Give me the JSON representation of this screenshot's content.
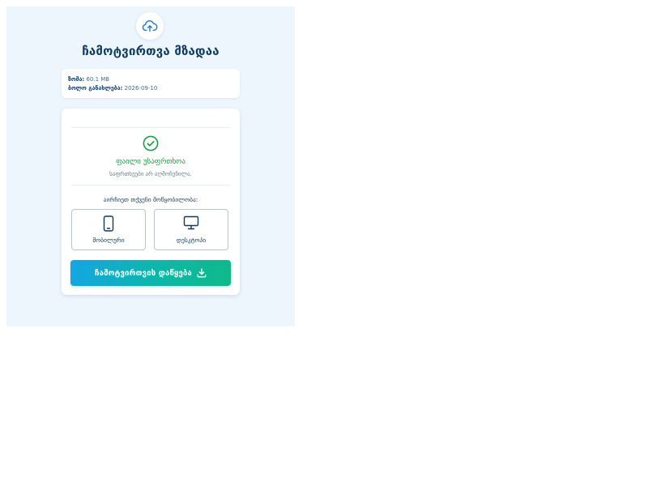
{
  "header": {
    "title": "ჩამოტვირთვა მზადაა",
    "upload_icon": "cloud-upload-icon"
  },
  "file_info": {
    "size_label": "ზომა:",
    "size_value": "60.1 MB",
    "updated_label": "ბოლო განახლება:",
    "updated_value": "2026-09-10"
  },
  "status": {
    "icon": "check-circle-icon",
    "title": "ფაილი უსაფრთხოა",
    "subtitle": "საფრთხეები არ აღმოჩენილა.",
    "color": "#1f9a48"
  },
  "device_select": {
    "prompt": "აირჩიეთ თქვენი მოწყობილობა:",
    "options": [
      {
        "label": "მობილური",
        "icon": "smartphone-icon"
      },
      {
        "label": "დესკტოპი",
        "icon": "monitor-icon"
      }
    ]
  },
  "download": {
    "label": "ჩამოტვირთვის დაწყება",
    "icon": "download-icon",
    "gradient_start": "#14a6e2",
    "gradient_end": "#10b98a"
  },
  "colors": {
    "page_background": "#eef6fd",
    "title": "#0f3b5f",
    "accent": "#12395a"
  }
}
